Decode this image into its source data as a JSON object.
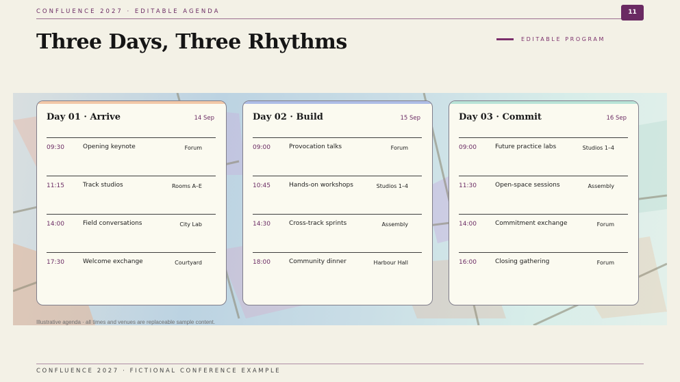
{
  "header": {
    "kicker": "CONFLUENCE 2027 · EDITABLE AGENDA",
    "page_number": "11",
    "title": "Three Days, Three Rhythms",
    "program_tag": "EDITABLE PROGRAM"
  },
  "days": [
    {
      "title": "Day 01 · Arrive",
      "date": "14 Sep",
      "accent": "#f2c7a7",
      "sessions": [
        {
          "time": "09:30",
          "name": "Opening keynote",
          "venue": "Forum"
        },
        {
          "time": "11:15",
          "name": "Track studios",
          "venue": "Rooms A–E"
        },
        {
          "time": "14:00",
          "name": "Field conversations",
          "venue": "City Lab"
        },
        {
          "time": "17:30",
          "name": "Welcome exchange",
          "venue": "Courtyard"
        }
      ]
    },
    {
      "title": "Day 02 · Build",
      "date": "15 Sep",
      "accent": "#aebde6",
      "sessions": [
        {
          "time": "09:00",
          "name": "Provocation talks",
          "venue": "Forum"
        },
        {
          "time": "10:45",
          "name": "Hands-on workshops",
          "venue": "Studios 1–4"
        },
        {
          "time": "14:30",
          "name": "Cross-track sprints",
          "venue": "Assembly"
        },
        {
          "time": "18:00",
          "name": "Community dinner",
          "venue": "Harbour Hall"
        }
      ]
    },
    {
      "title": "Day 03 · Commit",
      "date": "16 Sep",
      "accent": "#b8e3d7",
      "sessions": [
        {
          "time": "09:00",
          "name": "Future practice labs",
          "venue": "Studios 1–4"
        },
        {
          "time": "11:30",
          "name": "Open-space sessions",
          "venue": "Assembly"
        },
        {
          "time": "14:00",
          "name": "Commitment exchange",
          "venue": "Forum"
        },
        {
          "time": "16:00",
          "name": "Closing gathering",
          "venue": "Forum"
        }
      ]
    }
  ],
  "footnote": "Illustrative agenda · all times and venues are replaceable sample content.",
  "footer": {
    "text": "CONFLUENCE 2027 · FICTIONAL CONFERENCE EXAMPLE"
  },
  "colors": {
    "brand": "#6a2a63",
    "background": "#f3f1e6",
    "card": "#fbfaf0"
  }
}
